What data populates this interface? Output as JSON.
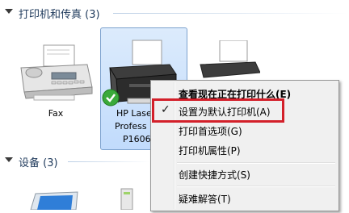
{
  "groups": {
    "printers_header": "打印机和传真 (3)",
    "devices_header": "设备 (3)"
  },
  "printers": [
    {
      "name": "Fax"
    },
    {
      "name_line1": "HP Lase",
      "name_line2": "Profess",
      "name_line3": "P1606"
    }
  ],
  "context_menu": {
    "items": [
      {
        "label": "查看现在正在打印什么(E)",
        "bold": true
      },
      {
        "label": "设置为默认打印机(A)",
        "checked": true,
        "highlighted": true
      },
      {
        "label": "打印首选项(G)"
      },
      {
        "label": "打印机属性(P)"
      },
      {
        "label": "创建快捷方式(S)"
      },
      {
        "label": "疑难解答(T)"
      }
    ],
    "check_glyph": "✓"
  },
  "colors": {
    "selection_fill": "#c9e0fc",
    "highlight_border": "#d3202a",
    "header_text": "#1e395b"
  }
}
